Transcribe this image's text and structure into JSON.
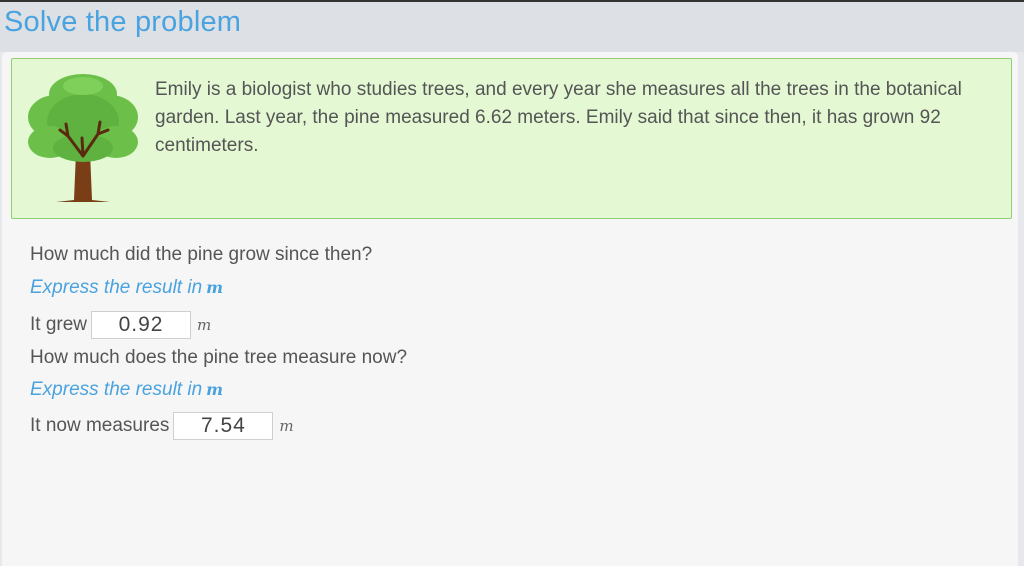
{
  "page_title": "Solve the problem",
  "statement": {
    "image_icon": "tree-icon",
    "text": "Emily is a biologist who studies trees, and every year she measures all the trees in the botanical garden. Last year, the pine measured 6.62 meters. Emily said that since then, it has grown 92 centimeters."
  },
  "questions": [
    {
      "question": "How much did the pine grow since then?",
      "hint_text": "Express the result in",
      "hint_unit": "m",
      "answer_label": "It grew",
      "answer_value": "0.92",
      "answer_unit": "m"
    },
    {
      "question": "How much does the pine tree measure now?",
      "hint_text": "Express the result in",
      "hint_unit": "m",
      "answer_label": "It now measures",
      "answer_value": "7.54",
      "answer_unit": "m"
    }
  ],
  "colors": {
    "accent": "#4aa3df",
    "statement_bg": "#e3f8d3",
    "statement_border": "#8fcf71",
    "text": "#555555"
  }
}
